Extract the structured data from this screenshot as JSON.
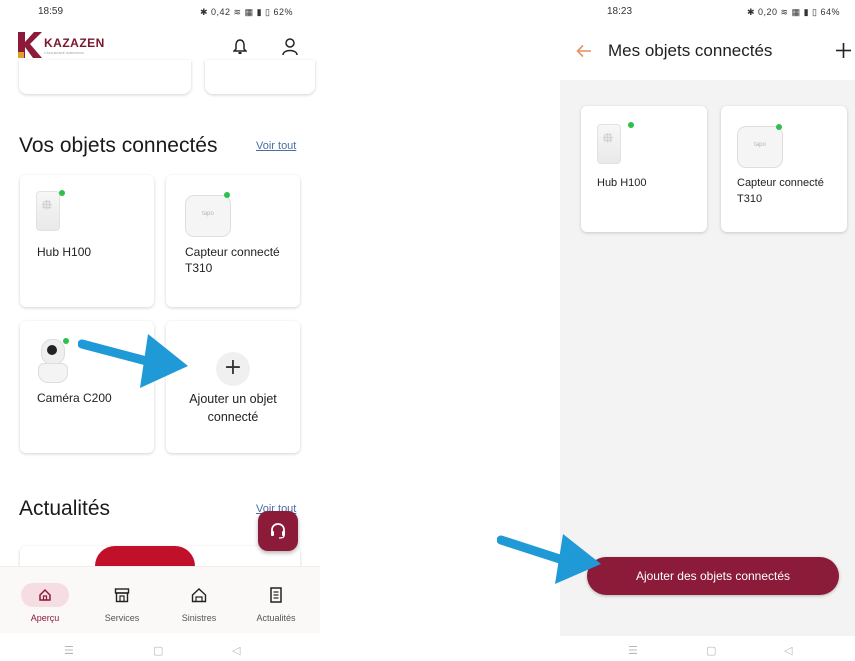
{
  "left_screen": {
    "status_bar": {
      "time": "18:59",
      "icons": "✱ 0,42 ≋ ▦ ▮ ▯ 62%"
    },
    "header": {
      "logo_letter": "K",
      "logo_text": "KAZAZEN",
      "logo_tagline": "L'ASSURANCE HABITATION"
    },
    "connected_section": {
      "title": "Vos objets connectés",
      "see_all": "Voir tout",
      "devices": [
        {
          "label": "Hub H100",
          "icon": "hub-icon"
        },
        {
          "label": "Capteur connecté T310",
          "icon": "sensor-icon",
          "image_text": "tapo"
        },
        {
          "label": "Caméra C200",
          "icon": "camera-icon"
        }
      ],
      "add_card": {
        "label": "Ajouter un objet connecté",
        "icon": "plus-icon"
      }
    },
    "news_section": {
      "title": "Actualités",
      "see_all": "Voir tout"
    },
    "bottom_nav": [
      {
        "label": "Aperçu",
        "icon": "home-icon",
        "active": true
      },
      {
        "label": "Services",
        "icon": "store-icon",
        "active": false
      },
      {
        "label": "Sinistres",
        "icon": "house-claim-icon",
        "active": false
      },
      {
        "label": "Actualités",
        "icon": "news-icon",
        "active": false
      }
    ],
    "system_nav": {
      "menu": "☰",
      "home": "▢",
      "back": "◁"
    }
  },
  "right_screen": {
    "status_bar": {
      "time": "18:23",
      "icons": "✱ 0,20 ≋ ▦ ▮ ▯ 64%"
    },
    "header": {
      "title": "Mes objets connectés",
      "back_icon": "arrow-left-icon",
      "add_icon": "plus-icon"
    },
    "devices": [
      {
        "label": "Hub H100",
        "icon": "hub-icon"
      },
      {
        "label": "Capteur connecté T310",
        "icon": "sensor-icon",
        "image_text": "tapo"
      }
    ],
    "add_button": {
      "label": "Ajouter des objets connectés"
    },
    "system_nav": {
      "menu": "☰",
      "home": "▢",
      "back": "◁"
    }
  },
  "colors": {
    "brand": "#8c1b3a",
    "accent_link": "#4a6fa5",
    "status_online": "#2fbf4a",
    "annotation_arrow": "#1f9ad6",
    "back_arrow": "#e3956a"
  }
}
